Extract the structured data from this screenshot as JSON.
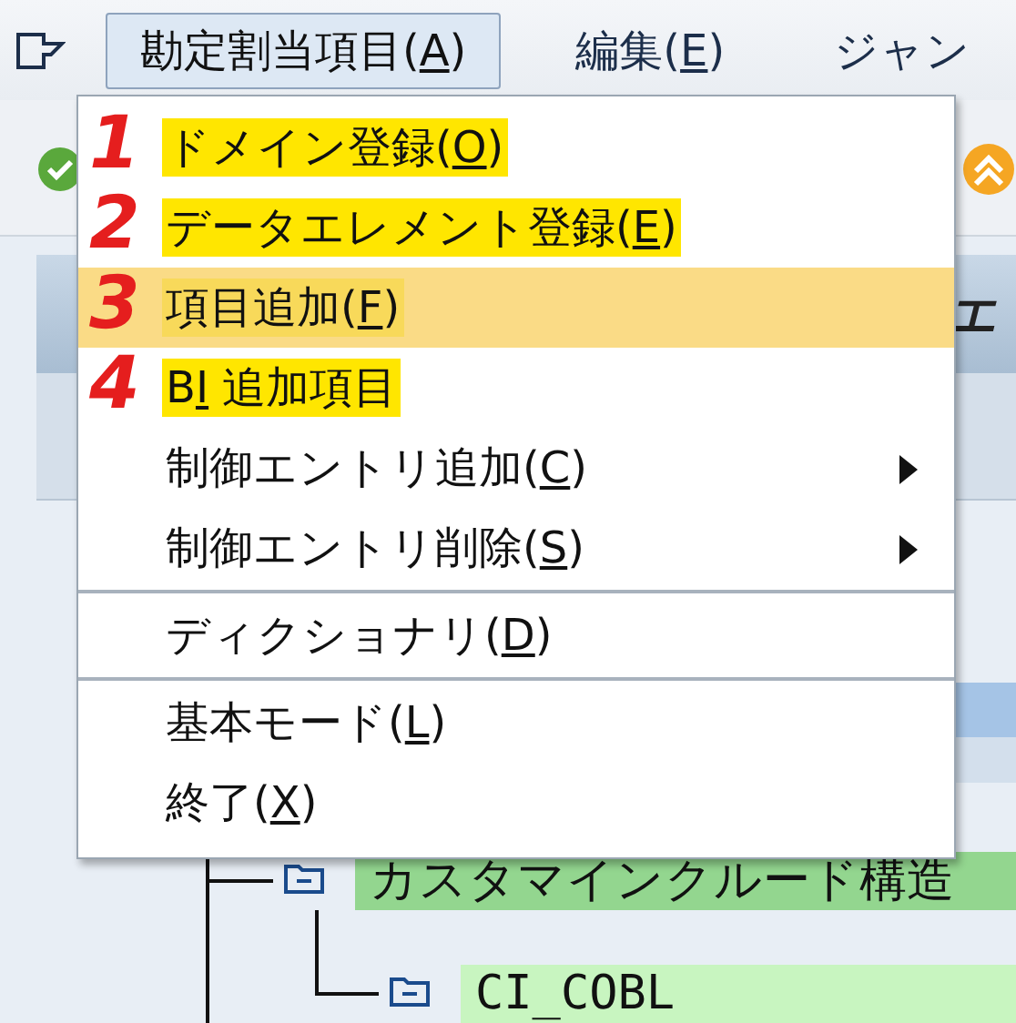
{
  "menubar": {
    "items": [
      {
        "pre": "勘定割当項目(",
        "key": "A",
        "post": ")",
        "selected": true
      },
      {
        "pre": "編集(",
        "key": "E",
        "post": ")",
        "selected": false
      },
      {
        "pre": "ジャン",
        "selected": false
      }
    ]
  },
  "panel": {
    "header_text": "エ"
  },
  "tree": {
    "children": [
      {
        "label": "カスタマインクルード構造",
        "color": "#93d68f",
        "children": [
          {
            "label": "CI_COBL",
            "color": "#c8f5c0"
          }
        ]
      }
    ]
  },
  "menu": {
    "items": [
      {
        "kind": "item",
        "pre": "ドメイン登録(",
        "key": "O",
        "post": ")",
        "selected": false,
        "has_submenu": false,
        "highlighted": true,
        "annotation": "1"
      },
      {
        "kind": "item",
        "pre": "データエレメント登録(",
        "key": "E",
        "post": ")",
        "selected": false,
        "has_submenu": false,
        "highlighted": true,
        "annotation": "2"
      },
      {
        "kind": "item",
        "pre": "項目追加(",
        "key": "F",
        "post": ")",
        "selected": true,
        "has_submenu": false,
        "highlighted": true,
        "annotation": "3"
      },
      {
        "kind": "item",
        "pre": "B",
        "key": "I",
        "post": " 追加項目",
        "selected": false,
        "has_submenu": false,
        "highlighted": true,
        "annotation": "4"
      },
      {
        "kind": "item",
        "pre": "制御エントリ追加(",
        "key": "C",
        "post": ")",
        "selected": false,
        "has_submenu": true,
        "highlighted": false
      },
      {
        "kind": "item",
        "pre": "制御エントリ削除(",
        "key": "S",
        "post": ")",
        "selected": false,
        "has_submenu": true,
        "highlighted": false
      },
      {
        "kind": "separator"
      },
      {
        "kind": "item",
        "pre": "ディクショナリ(",
        "key": "D",
        "post": ")",
        "selected": false,
        "has_submenu": false,
        "highlighted": false
      },
      {
        "kind": "separator"
      },
      {
        "kind": "item",
        "pre": "基本モード(",
        "key": "L",
        "post": ")",
        "selected": false,
        "has_submenu": false,
        "highlighted": false
      },
      {
        "kind": "item",
        "pre": "終了(",
        "key": "X",
        "post": ")",
        "selected": false,
        "has_submenu": false,
        "highlighted": false
      }
    ]
  }
}
